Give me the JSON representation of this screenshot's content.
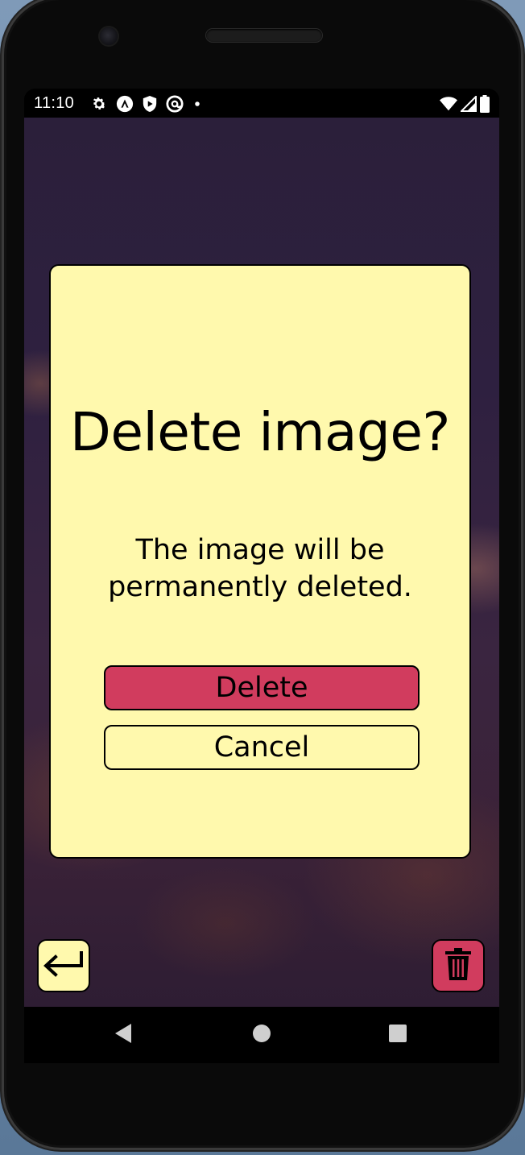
{
  "status_bar": {
    "time": "11:10",
    "left_icons": [
      "gear-icon",
      "android-studio-icon",
      "play-protect-icon",
      "at-sign-icon",
      "dot-icon"
    ],
    "right_icons": [
      "wifi-icon",
      "signal-icon",
      "battery-icon"
    ]
  },
  "dialog": {
    "title": "Delete image?",
    "message": "The image will be permanently deleted.",
    "delete_label": "Delete",
    "cancel_label": "Cancel"
  },
  "fab": {
    "back_icon": "return-arrow-icon",
    "delete_icon": "trash-icon"
  },
  "nav": {
    "back_icon": "triangle-back-icon",
    "home_icon": "circle-home-icon",
    "recents_icon": "square-recents-icon"
  },
  "colors": {
    "dialog_background": "#fff9ad",
    "delete_accent": "#d13c5e",
    "border": "#000000"
  }
}
